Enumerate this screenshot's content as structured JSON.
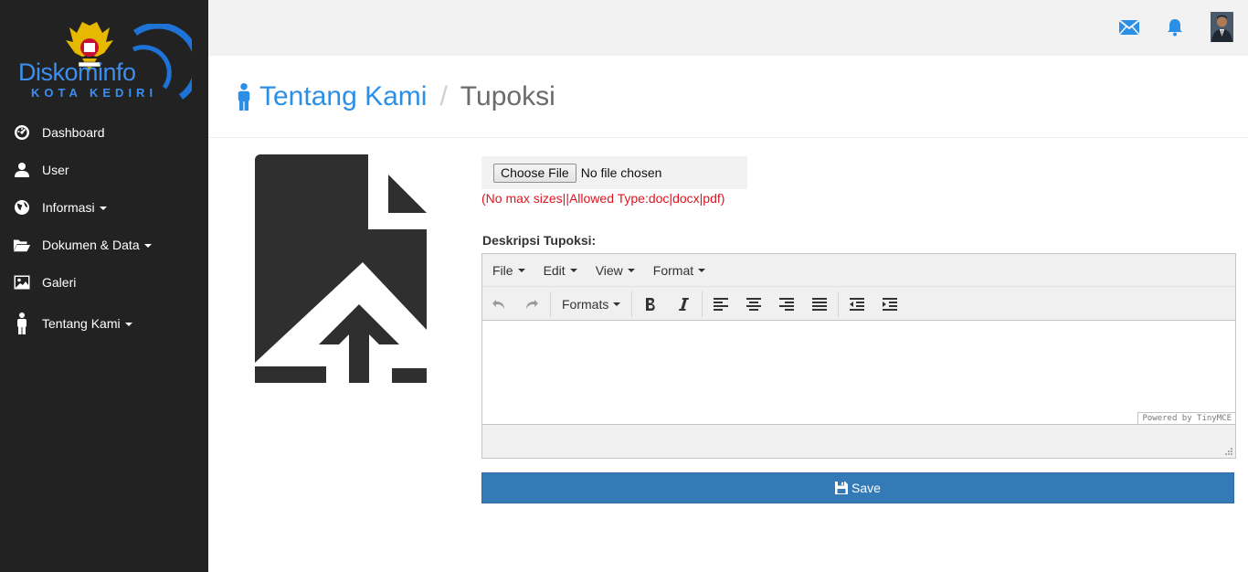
{
  "brand": {
    "name": "Diskominfo",
    "sub": "KOTA KEDIRI"
  },
  "sidebar": {
    "items": [
      {
        "label": "Dashboard",
        "icon": "dashboard-icon",
        "caret": false
      },
      {
        "label": "User",
        "icon": "user-icon",
        "caret": false
      },
      {
        "label": "Informasi",
        "icon": "globe-icon",
        "caret": true
      },
      {
        "label": "Dokumen & Data",
        "icon": "folder-open-icon",
        "caret": true
      },
      {
        "label": "Galeri",
        "icon": "picture-icon",
        "caret": false
      },
      {
        "label": "Tentang Kami",
        "icon": "person-icon",
        "caret": true
      }
    ]
  },
  "topbar": {
    "icons": [
      "envelope-icon",
      "bell-icon",
      "avatar"
    ]
  },
  "header": {
    "section": "Tentang Kami",
    "separator": "/",
    "current": "Tupoksi"
  },
  "upload": {
    "button_label": "Choose File",
    "status": "No file chosen",
    "hint": "(No max sizes||Allowed Type:doc|docx|pdf)"
  },
  "form": {
    "description_label": "Deskripsi Tupoksi:"
  },
  "editor": {
    "menus": [
      "File",
      "Edit",
      "View",
      "Format"
    ],
    "formats_label": "Formats",
    "powered": "Powered by TinyMCE"
  },
  "actions": {
    "save_label": "Save"
  },
  "colors": {
    "sidebar": "#222222",
    "accent": "#2b8fe6",
    "primary": "#337ab7",
    "hint": "#e0141e"
  }
}
